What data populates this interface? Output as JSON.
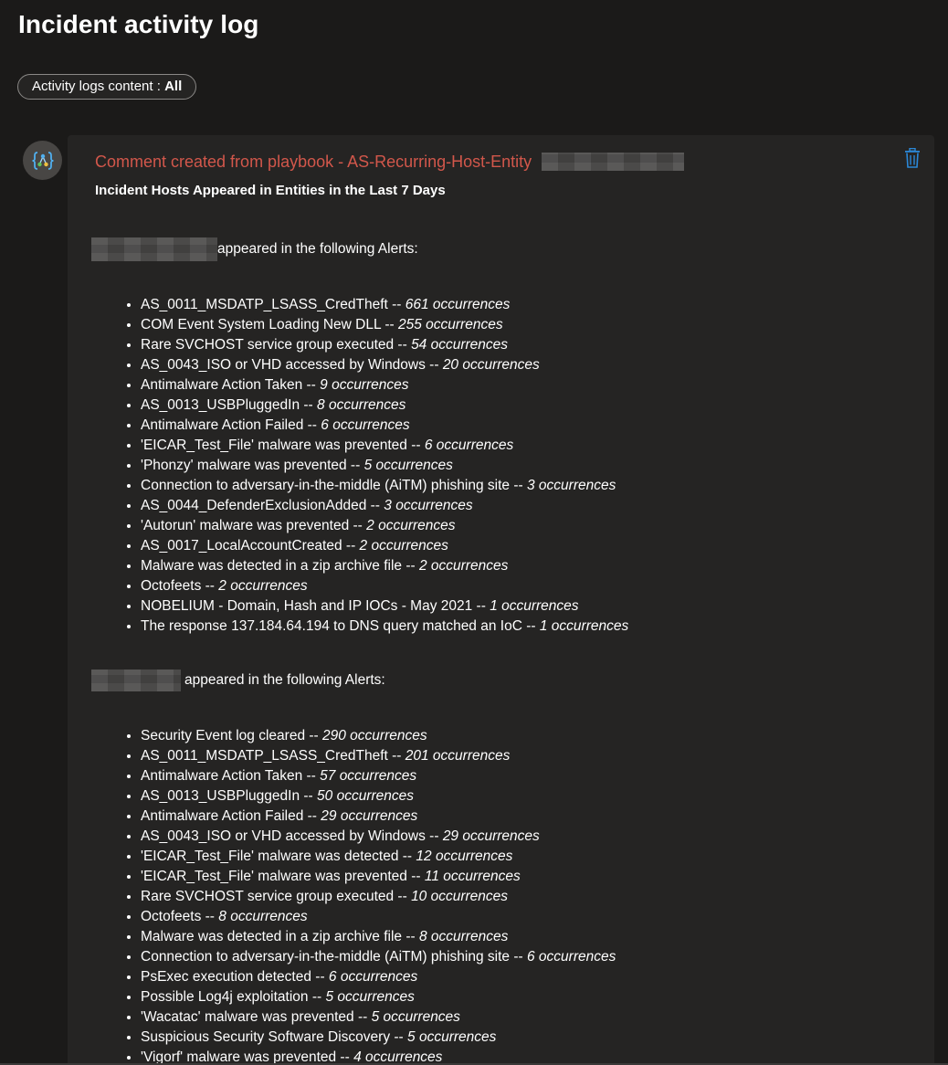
{
  "page": {
    "title": "Incident activity log"
  },
  "filter": {
    "label": "Activity logs content :",
    "value": "All"
  },
  "card": {
    "title": "Comment created from playbook - AS-Recurring-Host-Entity",
    "subtitle": "Incident Hosts Appeared in Entities in the Last 7 Days",
    "icons": {
      "avatar": "playbook-logic-app-icon",
      "delete": "trash-icon"
    },
    "colors": {
      "title": "#d2574b",
      "delete_icon": "#2b88d8",
      "avatar_icon": "#50b0f0"
    },
    "hosts": [
      {
        "suffix": "appeared in the following Alerts:",
        "alerts": [
          {
            "name": "AS_0011_MSDATP_LSASS_CredTheft --",
            "occ": "661 occurrences"
          },
          {
            "name": "COM Event System Loading New DLL --",
            "occ": "255 occurrences"
          },
          {
            "name": "Rare SVCHOST service group executed --",
            "occ": "54 occurrences"
          },
          {
            "name": "AS_0043_ISO or VHD accessed by Windows --",
            "occ": "20 occurrences"
          },
          {
            "name": "Antimalware Action Taken --",
            "occ": "9 occurrences"
          },
          {
            "name": "AS_0013_USBPluggedIn --",
            "occ": "8 occurrences"
          },
          {
            "name": "Antimalware Action Failed --",
            "occ": "6 occurrences"
          },
          {
            "name": "'EICAR_Test_File' malware was prevented --",
            "occ": "6 occurrences"
          },
          {
            "name": "'Phonzy' malware was prevented --",
            "occ": "5 occurrences"
          },
          {
            "name": "Connection to adversary-in-the-middle (AiTM) phishing site --",
            "occ": "3 occurrences"
          },
          {
            "name": "AS_0044_DefenderExclusionAdded --",
            "occ": "3 occurrences"
          },
          {
            "name": "'Autorun' malware was prevented --",
            "occ": "2 occurrences"
          },
          {
            "name": "AS_0017_LocalAccountCreated --",
            "occ": "2 occurrences"
          },
          {
            "name": "Malware was detected in a zip archive file --",
            "occ": "2 occurrences"
          },
          {
            "name": "Octofeets --",
            "occ": "2 occurrences"
          },
          {
            "name": "NOBELIUM - Domain, Hash and IP IOCs - May 2021 --",
            "occ": "1 occurrences"
          },
          {
            "name": "The response 137.184.64.194 to DNS query matched an IoC --",
            "occ": "1 occurrences"
          }
        ]
      },
      {
        "suffix": "appeared in the following Alerts:",
        "alerts": [
          {
            "name": "Security Event log cleared --",
            "occ": "290 occurrences"
          },
          {
            "name": "AS_0011_MSDATP_LSASS_CredTheft --",
            "occ": "201 occurrences"
          },
          {
            "name": "Antimalware Action Taken --",
            "occ": "57 occurrences"
          },
          {
            "name": "AS_0013_USBPluggedIn --",
            "occ": "50 occurrences"
          },
          {
            "name": "Antimalware Action Failed --",
            "occ": "29 occurrences"
          },
          {
            "name": "AS_0043_ISO or VHD accessed by Windows --",
            "occ": "29 occurrences"
          },
          {
            "name": "'EICAR_Test_File' malware was detected --",
            "occ": "12 occurrences"
          },
          {
            "name": "'EICAR_Test_File' malware was prevented --",
            "occ": "11 occurrences"
          },
          {
            "name": "Rare SVCHOST service group executed --",
            "occ": "10 occurrences"
          },
          {
            "name": "Octofeets --",
            "occ": "8 occurrences"
          },
          {
            "name": "Malware was detected in a zip archive file --",
            "occ": "8 occurrences"
          },
          {
            "name": "Connection to adversary-in-the-middle (AiTM) phishing site --",
            "occ": "6 occurrences"
          },
          {
            "name": "PsExec execution detected --",
            "occ": "6 occurrences"
          },
          {
            "name": "Possible Log4j exploitation --",
            "occ": "5 occurrences"
          },
          {
            "name": "'Wacatac' malware was prevented --",
            "occ": "5 occurrences"
          },
          {
            "name": "Suspicious Security Software Discovery --",
            "occ": "5 occurrences"
          },
          {
            "name": "'Vigorf' malware was prevented --",
            "occ": "4 occurrences"
          }
        ]
      }
    ]
  }
}
